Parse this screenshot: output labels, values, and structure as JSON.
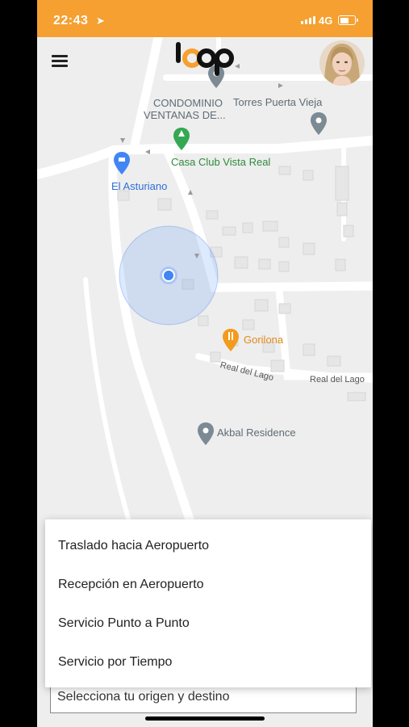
{
  "status_bar": {
    "time": "22:43",
    "network": "4G"
  },
  "header": {
    "logo_text": "loop"
  },
  "map": {
    "pois": [
      {
        "name": "CONDOMINIO",
        "line2": "VENTANAS DE...",
        "color": "gray"
      },
      {
        "name": "Torres Puerta Vieja",
        "color": "gray"
      },
      {
        "name": "Casa Club Vista Real",
        "color": "green"
      },
      {
        "name": "El Asturiano",
        "color": "blue"
      },
      {
        "name": "Gorilona",
        "color": "orange"
      },
      {
        "name": "Akbal Residence",
        "color": "gray"
      }
    ],
    "streets": [
      "Real del Lago",
      "Real del Lago"
    ]
  },
  "service_menu": {
    "options": [
      "Traslado hacia Aeropuerto",
      "Recepción en Aeropuerto",
      "Servicio Punto a Punto",
      "Servicio por Tiempo"
    ]
  },
  "origin_input": {
    "placeholder": "Selecciona tu origen y destino"
  },
  "colors": {
    "accent": "#f5a030",
    "location_blue": "#4285f4"
  }
}
